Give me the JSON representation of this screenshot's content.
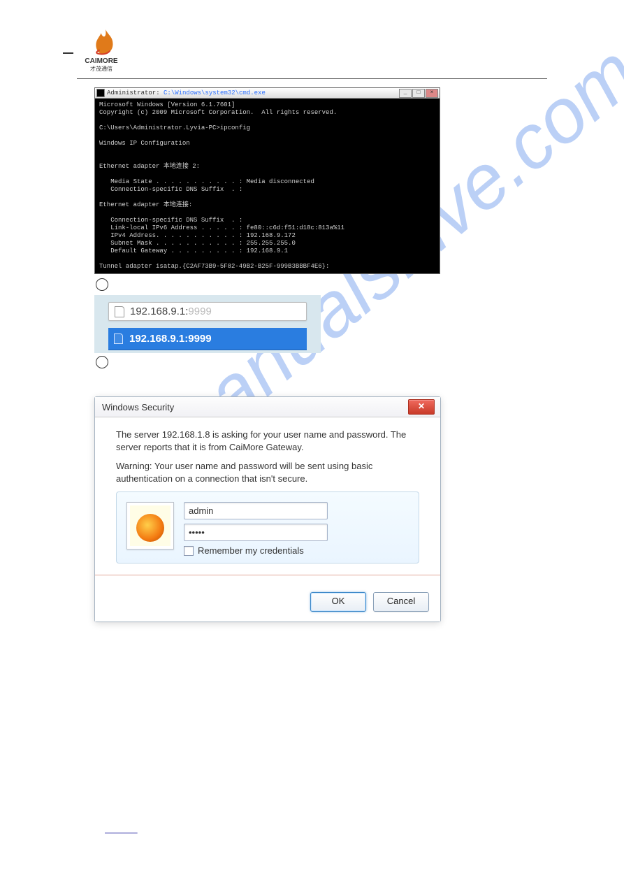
{
  "header": {
    "brand": "CAIMORE",
    "brand_sub": "才茂通信"
  },
  "cmd": {
    "title_prefix": "Administrator: ",
    "title_path": "C:\\Windows\\system32\\cmd.exe",
    "body": "Microsoft Windows [Version 6.1.7601]\nCopyright (c) 2009 Microsoft Corporation.  All rights reserved.\n\nC:\\Users\\Administrator.Lyvia-PC>ipconfig\n\nWindows IP Configuration\n\n\nEthernet adapter 本地连接 2:\n\n   Media State . . . . . . . . . . . : Media disconnected\n   Connection-specific DNS Suffix  . :\n\nEthernet adapter 本地连接:\n\n   Connection-specific DNS Suffix  . :\n   Link-local IPv6 Address . . . . . : fe80::c6d:f51:d18c:813a%11\n   IPv4 Address. . . . . . . . . . . : 192.168.9.172\n   Subnet Mask . . . . . . . . . . . : 255.255.255.0\n   Default Gateway . . . . . . . . . : 192.168.9.1\n\nTunnel adapter isatap.{C2AF73B9-5F82-49B2-B25F-999B3BBBF4E6}:"
  },
  "browser": {
    "address_host": "192.168.9.1:",
    "address_port": "9999",
    "suggestion": "192.168.9.1:9999"
  },
  "security": {
    "title": "Windows Security",
    "close_label": "✕",
    "msg1": "The server 192.168.1.8 is asking for your user name and password. The server reports that it is from CaiMore Gateway.",
    "msg2": "Warning: Your user name and password will be sent using basic authentication on a connection that isn't secure.",
    "user_value": "admin",
    "pass_value": "•••••",
    "remember_label": "Remember my credentials",
    "ok_label": "OK",
    "cancel_label": "Cancel"
  },
  "watermark": "manualshive.com"
}
